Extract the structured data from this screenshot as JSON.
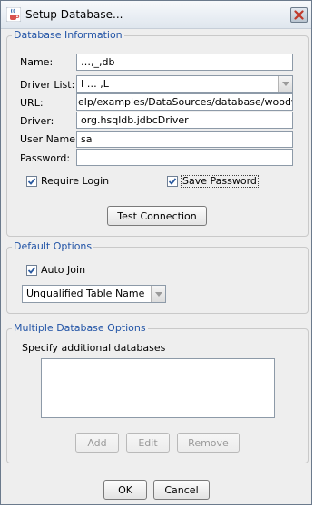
{
  "window": {
    "title": "Setup Database..."
  },
  "db_info": {
    "section_title": "Database Information",
    "name_label": "Name:",
    "name_value": "…,_,db",
    "driver_list_label": "Driver List:",
    "driver_list_value": "I … ,L",
    "url_label": "URL:",
    "url_value": "elp/examples/DataSources/database/woodview",
    "driver_label": "Driver:",
    "driver_value": "org.hsqldb.jdbcDriver",
    "username_label": "User Name:",
    "username_value": "sa",
    "password_label": "Password:",
    "password_value": "",
    "require_login_label": "Require Login",
    "require_login_checked": true,
    "save_password_label": "Save Password",
    "save_password_checked": true,
    "test_connection_label": "Test Connection"
  },
  "default_options": {
    "section_title": "Default Options",
    "auto_join_label": "Auto Join",
    "auto_join_checked": true,
    "table_name_value": "Unqualified Table Name"
  },
  "multi_db": {
    "section_title": "Multiple Database Options",
    "specify_label": "Specify additional databases",
    "databases": [],
    "add_label": "Add",
    "edit_label": "Edit",
    "remove_label": "Remove"
  },
  "footer": {
    "ok_label": "OK",
    "cancel_label": "Cancel"
  },
  "icons": {
    "app": "java-cup-icon",
    "close": "close-icon",
    "check": "checkmark-icon",
    "dropdown": "chevron-down-icon"
  },
  "colors": {
    "section_title": "#2254a6",
    "close_x": "#c0392b"
  }
}
